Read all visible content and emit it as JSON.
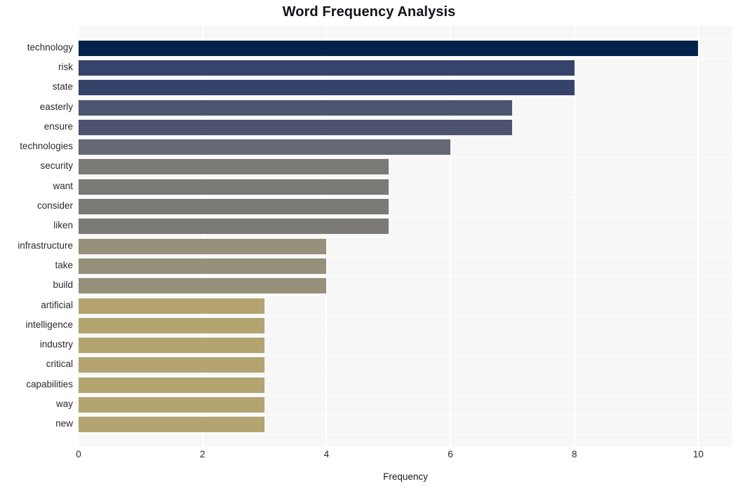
{
  "chart_data": {
    "type": "bar",
    "orientation": "horizontal",
    "title": "Word Frequency Analysis",
    "xlabel": "Frequency",
    "ylabel": "",
    "xlim": [
      0,
      10.55
    ],
    "xticks": [
      0,
      2,
      4,
      6,
      8,
      10
    ],
    "xtick_labels": [
      "0",
      "2",
      "4",
      "6",
      "8",
      "10"
    ],
    "grid": true,
    "grid_axis": "x",
    "legend": false,
    "categories": [
      "technology",
      "risk",
      "state",
      "easterly",
      "ensure",
      "technologies",
      "security",
      "want",
      "consider",
      "liken",
      "infrastructure",
      "take",
      "build",
      "artificial",
      "intelligence",
      "industry",
      "critical",
      "capabilities",
      "way",
      "new"
    ],
    "values": [
      10,
      8,
      8,
      7,
      7,
      6,
      5,
      5,
      5,
      5,
      4,
      4,
      4,
      3,
      3,
      3,
      3,
      3,
      3,
      3
    ],
    "bar_colors": [
      "#04234c",
      "#36436b",
      "#36436b",
      "#4c5470",
      "#4c5470",
      "#636873",
      "#7c7a76",
      "#7c7a76",
      "#7c7a76",
      "#7c7a76",
      "#96907a",
      "#96907a",
      "#96907a",
      "#b3a470",
      "#b3a470",
      "#b3a470",
      "#b3a470",
      "#b3a470",
      "#b3a470",
      "#b3a470"
    ],
    "plot_background": "#f7f7f7",
    "gridline_color": "#ffffff",
    "figure_background": "#ffffff"
  }
}
